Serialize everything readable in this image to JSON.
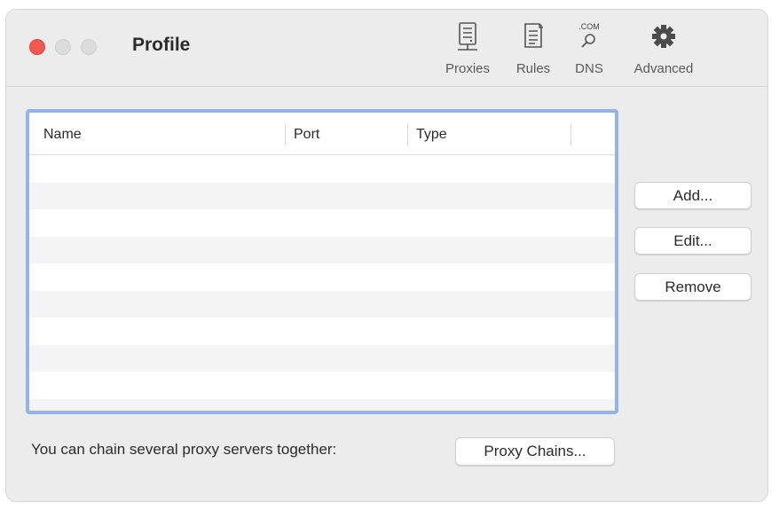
{
  "window": {
    "title": "Profile"
  },
  "toolbar": {
    "items": [
      {
        "label": "Proxies",
        "icon": "proxies-icon"
      },
      {
        "label": "Rules",
        "icon": "rules-icon"
      },
      {
        "label": "DNS",
        "icon": "dns-icon",
        "icon_text": ".COM"
      },
      {
        "label": "Advanced",
        "icon": "gear-icon"
      }
    ]
  },
  "table": {
    "columns": [
      "Name",
      "Port",
      "Type",
      ""
    ],
    "rows": []
  },
  "buttons": {
    "add": "Add...",
    "edit": "Edit...",
    "remove": "Remove"
  },
  "chain": {
    "label": "You can chain several proxy servers together:",
    "button": "Proxy Chains..."
  },
  "colors": {
    "close": "#ef5a52",
    "table_focus_border": "#93b3ec",
    "window_bg": "#ececec"
  }
}
